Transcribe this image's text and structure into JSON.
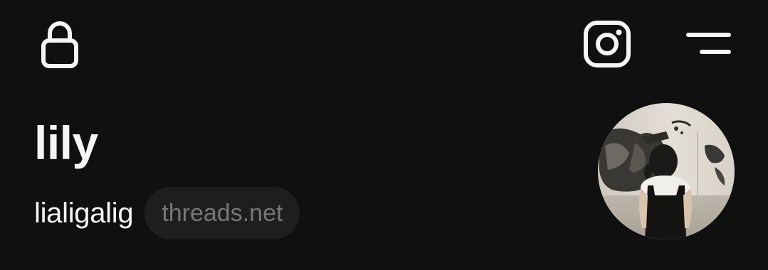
{
  "header": {
    "lock_icon": "lock-icon",
    "instagram_icon": "instagram-icon",
    "menu_icon": "menu-icon"
  },
  "profile": {
    "display_name": "lily",
    "username": "lialigalig",
    "domain_badge": "threads.net",
    "avatar_description_icon": "profile-photo"
  },
  "colors": {
    "background": "#101010",
    "text_primary": "#f3f5f7",
    "badge_bg": "#1e1e1e",
    "badge_text": "#777777"
  }
}
